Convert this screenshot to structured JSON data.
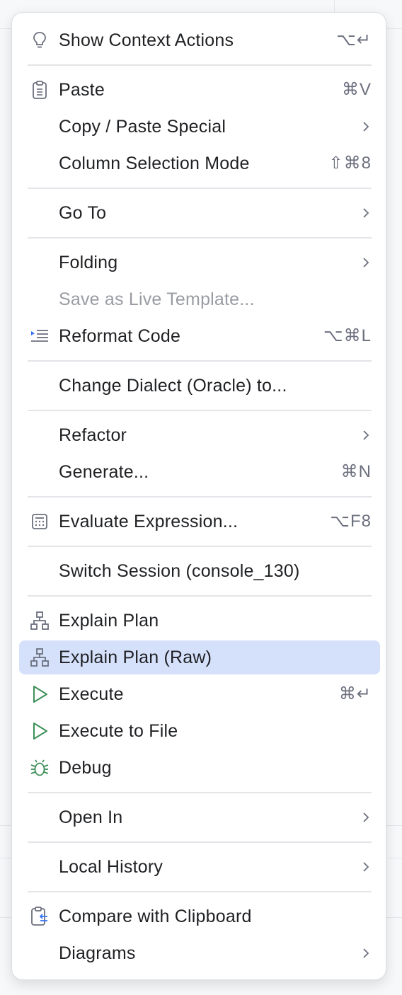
{
  "menu": {
    "items": [
      {
        "label": "Show Context Actions",
        "shortcut": "⌥↵",
        "icon": "lightbulb-icon"
      },
      {
        "label": "Paste",
        "shortcut": "⌘V",
        "icon": "clipboard-icon"
      },
      {
        "label": "Copy / Paste Special",
        "submenu": true
      },
      {
        "label": "Column Selection Mode",
        "shortcut": "⇧⌘8"
      },
      {
        "label": "Go To",
        "submenu": true
      },
      {
        "label": "Folding",
        "submenu": true
      },
      {
        "label": "Save as Live Template...",
        "disabled": true
      },
      {
        "label": "Reformat Code",
        "shortcut": "⌥⌘L",
        "icon": "reformat-icon"
      },
      {
        "label": "Change Dialect (Oracle) to..."
      },
      {
        "label": "Refactor",
        "submenu": true
      },
      {
        "label": "Generate...",
        "shortcut": "⌘N"
      },
      {
        "label": "Evaluate Expression...",
        "shortcut": "⌥F8",
        "icon": "calculator-icon"
      },
      {
        "label": "Switch Session (console_130)"
      },
      {
        "label": "Explain Plan",
        "icon": "hierarchy-icon"
      },
      {
        "label": "Explain Plan (Raw)",
        "icon": "hierarchy-icon",
        "selected": true
      },
      {
        "label": "Execute",
        "shortcut": "⌘↵",
        "icon": "play-icon"
      },
      {
        "label": "Execute to File",
        "icon": "play-icon"
      },
      {
        "label": "Debug",
        "icon": "bug-icon"
      },
      {
        "label": "Open In",
        "submenu": true
      },
      {
        "label": "Local History",
        "submenu": true
      },
      {
        "label": "Compare with Clipboard",
        "icon": "compare-clipboard-icon"
      },
      {
        "label": "Diagrams",
        "submenu": true
      }
    ]
  },
  "colors": {
    "selection": "#d5e1fb",
    "run_green": "#3d8f58",
    "icon_gray": "#6c707e",
    "accent_blue": "#3574f0"
  }
}
